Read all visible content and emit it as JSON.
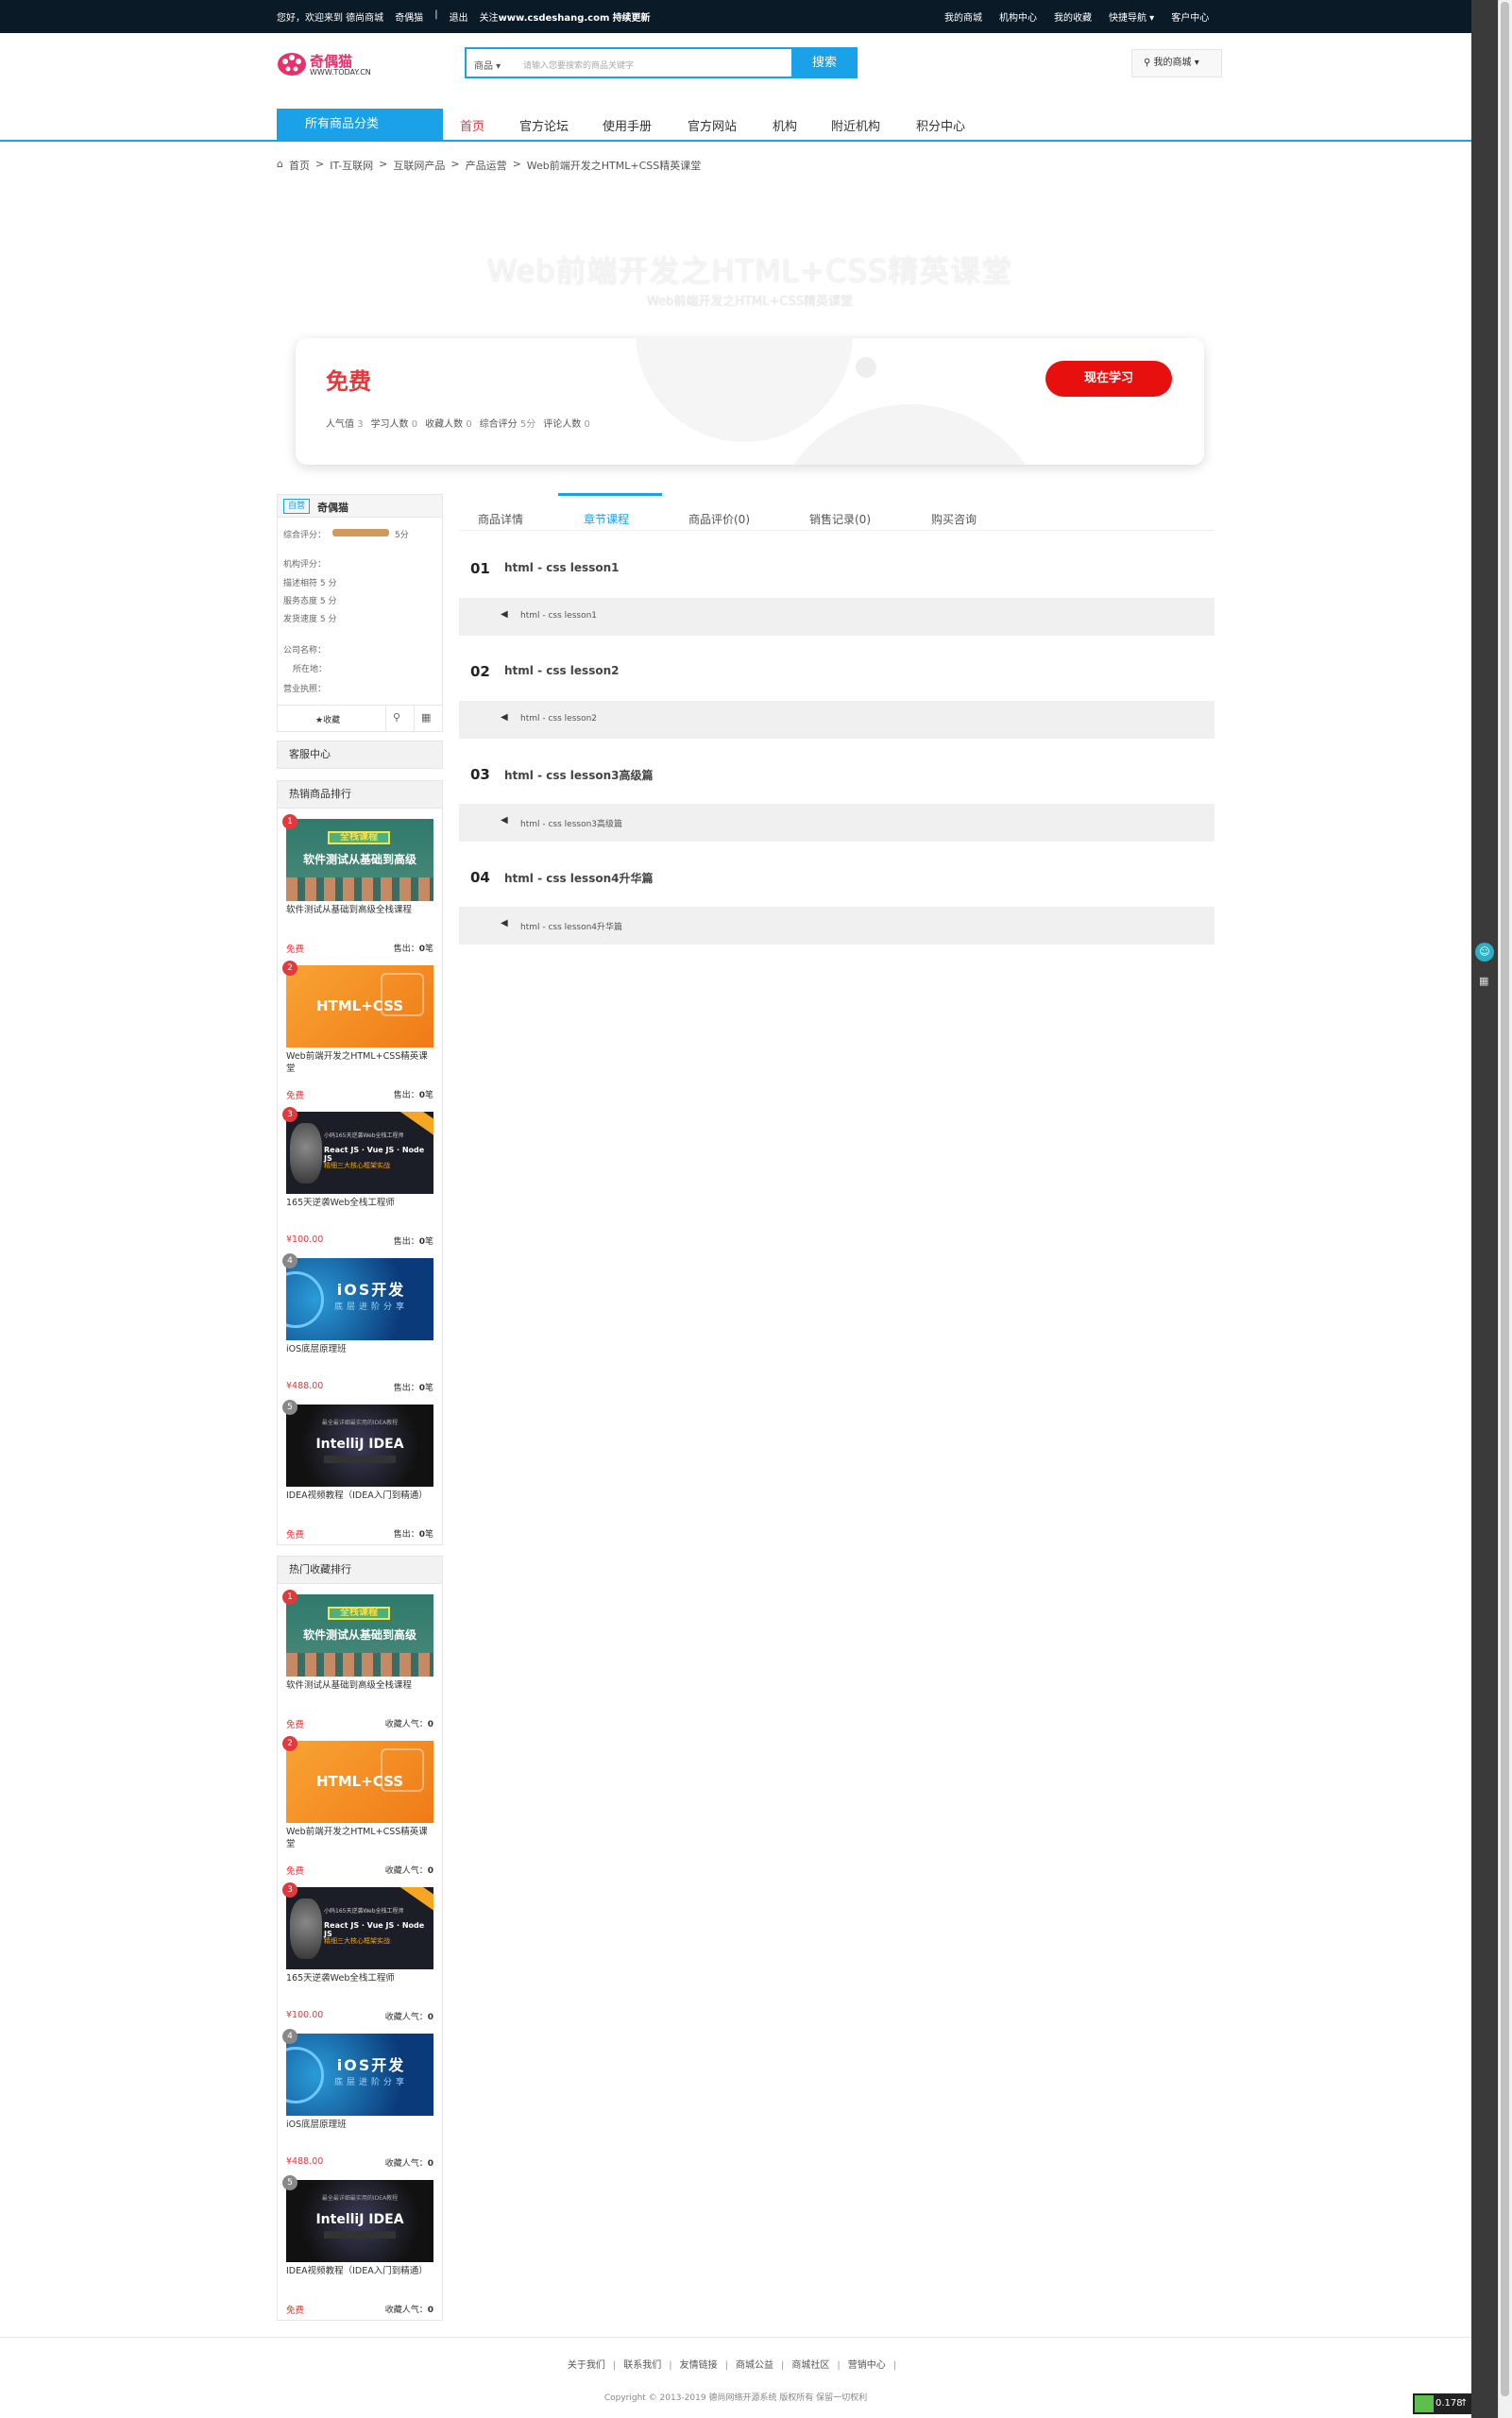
{
  "topbar": {
    "greeting": "您好，欢迎来到  德尚商城",
    "user": "奇偶猫",
    "sep": "|",
    "logout": "退出",
    "follow_prefix": "关注",
    "follow_site": "www.csdeshang.com",
    "follow_suffix": "持续更新",
    "right_links": [
      "我的商城",
      "机构中心",
      "我的收藏",
      "快捷导航 ▾",
      "客户中心"
    ]
  },
  "header": {
    "logo_text": "奇偶猫",
    "logo_sub": "WWW.TODAY.CN",
    "search_category": "商品 ▾",
    "search_placeholder": "请输入您要搜索的商品关键字",
    "search_button": "搜索",
    "my_mall": "我的商城 ▾"
  },
  "nav": {
    "all_categories": "所有商品分类",
    "items": [
      "首页",
      "官方论坛",
      "使用手册",
      "官方网站",
      "机构",
      "附近机构",
      "积分中心"
    ]
  },
  "breadcrumb": [
    "首页",
    ">",
    "IT-互联网",
    ">",
    "互联网产品",
    ">",
    "产品运营",
    ">",
    "Web前端开发之HTML+CSS精英课堂"
  ],
  "hero": {
    "title": "Web前端开发之HTML+CSS精英课堂",
    "subtitle": "Web前端开发之HTML+CSS精英课堂"
  },
  "pricecard": {
    "price": "免费",
    "stats": [
      {
        "label": "人气值",
        "value": "3"
      },
      {
        "label": "学习人数",
        "value": "0"
      },
      {
        "label": "收藏人数",
        "value": "0"
      },
      {
        "label": "综合评分",
        "value": "5分"
      },
      {
        "label": "评论人数",
        "value": "0"
      }
    ],
    "learn_button": "现在学习"
  },
  "shop": {
    "badge": "自营",
    "name": "奇偶猫",
    "overall_label": "综合评分：",
    "overall_value": "5分",
    "rating_title": "机构评分：",
    "ratings": [
      "描述相符 5 分",
      "服务态度 5 分",
      "发货速度 5 分"
    ],
    "company_label": "公司名称：",
    "location_label": "所在地：",
    "license_label": "营业执照：",
    "favorite": "★收藏"
  },
  "service_center": "客服中心",
  "hot_sales": {
    "title": "热销商品排行",
    "meta_label": "售出：",
    "meta_unit": "笔",
    "items": [
      {
        "rank": "1",
        "name": "软件测试从基础到高级全栈课程",
        "price": "免费",
        "count": "0"
      },
      {
        "rank": "2",
        "name": "Web前端开发之HTML+CSS精英课堂",
        "price": "免费",
        "count": "0"
      },
      {
        "rank": "3",
        "name": "165天逆袭Web全栈工程师",
        "price": "¥100.00",
        "count": "0"
      },
      {
        "rank": "4",
        "name": "iOS底层原理班",
        "price": "¥488.00",
        "count": "0"
      },
      {
        "rank": "5",
        "name": "IDEA视频教程（IDEA入门到精通）",
        "price": "免费",
        "count": "0"
      }
    ]
  },
  "hot_favorites": {
    "title": "热门收藏排行",
    "meta_label": "收藏人气：",
    "items": [
      {
        "rank": "1",
        "name": "软件测试从基础到高级全栈课程",
        "price": "免费",
        "count": "0"
      },
      {
        "rank": "2",
        "name": "Web前端开发之HTML+CSS精英课堂",
        "price": "免费",
        "count": "0"
      },
      {
        "rank": "3",
        "name": "165天逆袭Web全栈工程师",
        "price": "¥100.00",
        "count": "0"
      },
      {
        "rank": "4",
        "name": "iOS底层原理班",
        "price": "¥488.00",
        "count": "0"
      },
      {
        "rank": "5",
        "name": "IDEA视频教程（IDEA入门到精通）",
        "price": "免费",
        "count": "0"
      }
    ]
  },
  "product_images": {
    "test": {
      "t1": "全栈课程",
      "t2": "软件测试从基础到高级"
    },
    "html": {
      "t": "HTML+CSS"
    },
    "web": {
      "l1": "小码165天逆袭Web全栈工程师",
      "l2": "React JS · Vue JS · Node JS",
      "l3": "精细三大核心框架实战"
    },
    "ios": {
      "t1": "iOS开发",
      "t2": "底层进阶分享"
    },
    "idea": {
      "s": "最全最详细最实用的IDEA教程",
      "t": "IntelliJ IDEA"
    }
  },
  "tabs": [
    "商品详情",
    "章节课程",
    "商品评价(0)",
    "销售记录(0)",
    "购买咨询"
  ],
  "chapters": [
    {
      "num": "01",
      "title": "html - css lesson1",
      "lesson": "html - css lesson1"
    },
    {
      "num": "02",
      "title": "html - css lesson2",
      "lesson": "html - css lesson2"
    },
    {
      "num": "03",
      "title": "html - css lesson3高级篇",
      "lesson": "html - css lesson3高级篇"
    },
    {
      "num": "04",
      "title": "html - css lesson4升华篇",
      "lesson": "html - css lesson4升华篇"
    }
  ],
  "footer": {
    "links": [
      "关于我们",
      "联系我们",
      "友情链接",
      "商城公益",
      "商城社区",
      "营销中心"
    ],
    "separator": "|",
    "copyright": "Copyright © 2013-2019 德尚网络开源系统 版权所有 保留一切权利"
  },
  "perf": {
    "value": "0.178",
    "up": "↑"
  },
  "colors": {
    "accent": "#1aa1e8",
    "price_red": "#e4393c",
    "button_red": "#e8100e",
    "topbar": "#0a1a26"
  }
}
